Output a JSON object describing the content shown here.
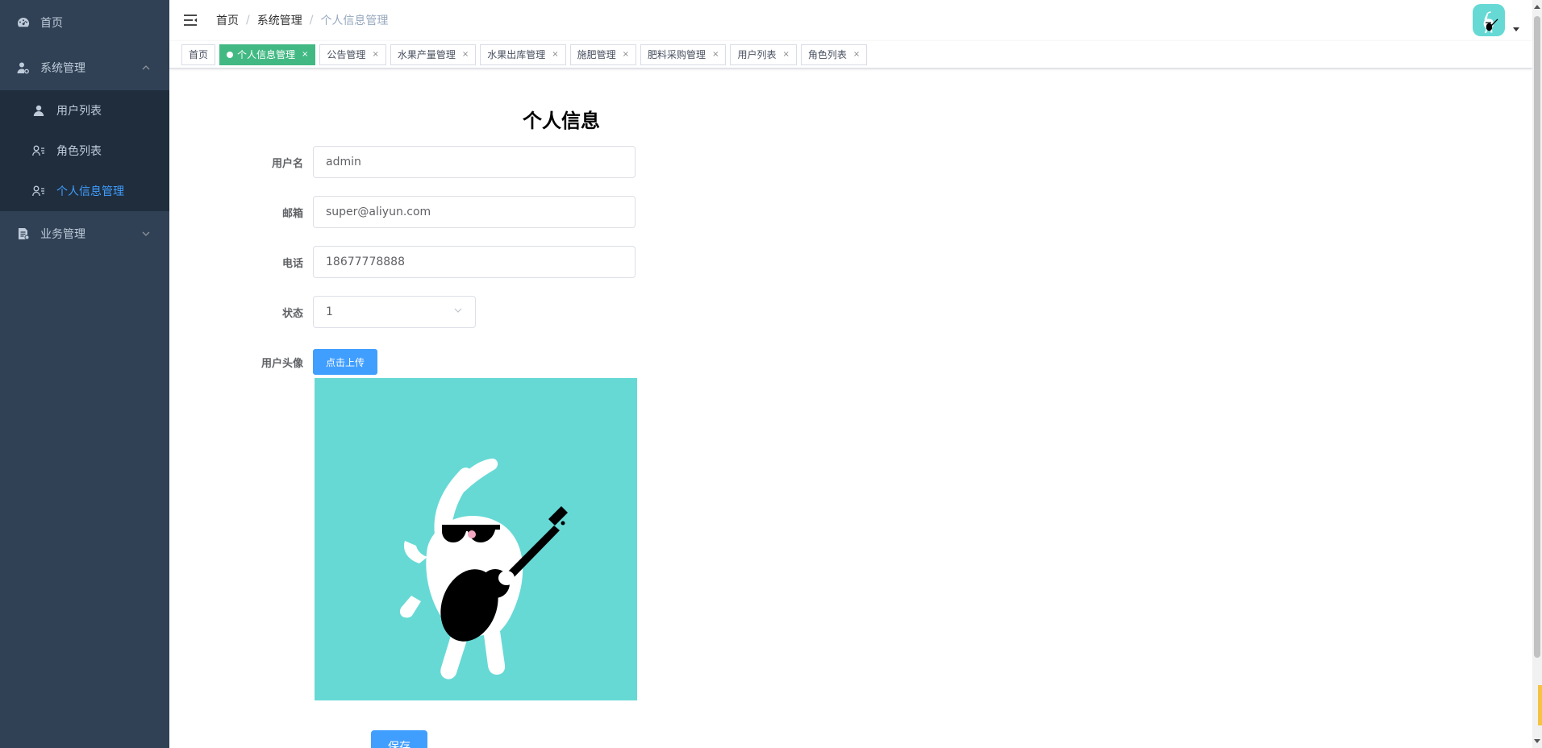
{
  "sidebar": {
    "home": "首页",
    "system": "系统管理",
    "system_items": [
      "用户列表",
      "角色列表",
      "个人信息管理"
    ],
    "business": "业务管理"
  },
  "breadcrumb": [
    "首页",
    "系统管理",
    "个人信息管理"
  ],
  "tags": [
    {
      "label": "首页",
      "active": false,
      "closable": false
    },
    {
      "label": "个人信息管理",
      "active": true,
      "closable": true
    },
    {
      "label": "公告管理",
      "active": false,
      "closable": true
    },
    {
      "label": "水果产量管理",
      "active": false,
      "closable": true
    },
    {
      "label": "水果出库管理",
      "active": false,
      "closable": true
    },
    {
      "label": "施肥管理",
      "active": false,
      "closable": true
    },
    {
      "label": "肥料采购管理",
      "active": false,
      "closable": true
    },
    {
      "label": "用户列表",
      "active": false,
      "closable": true
    },
    {
      "label": "角色列表",
      "active": false,
      "closable": true
    }
  ],
  "tag_close": "×",
  "form": {
    "title": "个人信息",
    "username_label": "用户名",
    "username": "admin",
    "email_label": "邮箱",
    "email": "super@aliyun.com",
    "phone_label": "电话",
    "phone": "18677778888",
    "status_label": "状态",
    "status": "1",
    "avatar_label": "用户头像",
    "upload_label": "点击上传",
    "save_label": "保存"
  },
  "colors": {
    "sidebar_bg": "#304156",
    "submenu_bg": "#1f2d3d",
    "active_menu": "#409eff",
    "active_tag": "#42b983",
    "primary": "#409eff",
    "avatar_bg": "#66d9d5"
  },
  "icons": {
    "home": "dashboard-icon",
    "system": "user-gear-icon",
    "user_list": "user-icon",
    "role_list": "user-list-icon",
    "profile": "user-list-icon",
    "business": "document-icon",
    "hamburger": "hamburger-icon"
  }
}
